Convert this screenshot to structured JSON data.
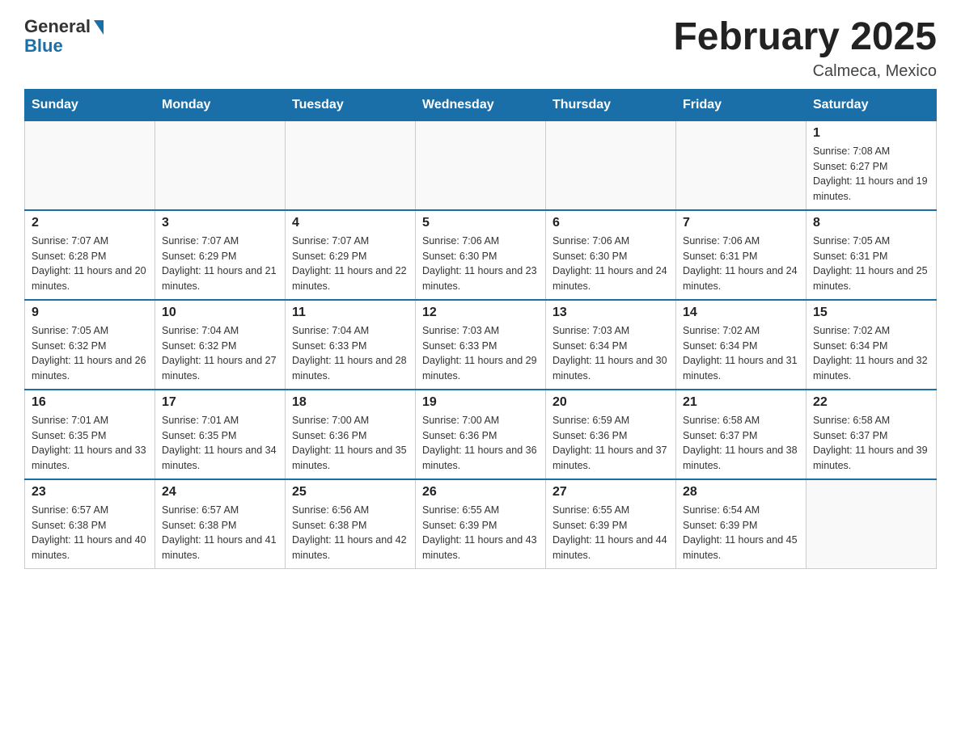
{
  "header": {
    "logo_general": "General",
    "logo_blue": "Blue",
    "month_title": "February 2025",
    "location": "Calmeca, Mexico"
  },
  "weekdays": [
    "Sunday",
    "Monday",
    "Tuesday",
    "Wednesday",
    "Thursday",
    "Friday",
    "Saturday"
  ],
  "weeks": [
    [
      {
        "day": "",
        "sunrise": "",
        "sunset": "",
        "daylight": ""
      },
      {
        "day": "",
        "sunrise": "",
        "sunset": "",
        "daylight": ""
      },
      {
        "day": "",
        "sunrise": "",
        "sunset": "",
        "daylight": ""
      },
      {
        "day": "",
        "sunrise": "",
        "sunset": "",
        "daylight": ""
      },
      {
        "day": "",
        "sunrise": "",
        "sunset": "",
        "daylight": ""
      },
      {
        "day": "",
        "sunrise": "",
        "sunset": "",
        "daylight": ""
      },
      {
        "day": "1",
        "sunrise": "Sunrise: 7:08 AM",
        "sunset": "Sunset: 6:27 PM",
        "daylight": "Daylight: 11 hours and 19 minutes."
      }
    ],
    [
      {
        "day": "2",
        "sunrise": "Sunrise: 7:07 AM",
        "sunset": "Sunset: 6:28 PM",
        "daylight": "Daylight: 11 hours and 20 minutes."
      },
      {
        "day": "3",
        "sunrise": "Sunrise: 7:07 AM",
        "sunset": "Sunset: 6:29 PM",
        "daylight": "Daylight: 11 hours and 21 minutes."
      },
      {
        "day": "4",
        "sunrise": "Sunrise: 7:07 AM",
        "sunset": "Sunset: 6:29 PM",
        "daylight": "Daylight: 11 hours and 22 minutes."
      },
      {
        "day": "5",
        "sunrise": "Sunrise: 7:06 AM",
        "sunset": "Sunset: 6:30 PM",
        "daylight": "Daylight: 11 hours and 23 minutes."
      },
      {
        "day": "6",
        "sunrise": "Sunrise: 7:06 AM",
        "sunset": "Sunset: 6:30 PM",
        "daylight": "Daylight: 11 hours and 24 minutes."
      },
      {
        "day": "7",
        "sunrise": "Sunrise: 7:06 AM",
        "sunset": "Sunset: 6:31 PM",
        "daylight": "Daylight: 11 hours and 24 minutes."
      },
      {
        "day": "8",
        "sunrise": "Sunrise: 7:05 AM",
        "sunset": "Sunset: 6:31 PM",
        "daylight": "Daylight: 11 hours and 25 minutes."
      }
    ],
    [
      {
        "day": "9",
        "sunrise": "Sunrise: 7:05 AM",
        "sunset": "Sunset: 6:32 PM",
        "daylight": "Daylight: 11 hours and 26 minutes."
      },
      {
        "day": "10",
        "sunrise": "Sunrise: 7:04 AM",
        "sunset": "Sunset: 6:32 PM",
        "daylight": "Daylight: 11 hours and 27 minutes."
      },
      {
        "day": "11",
        "sunrise": "Sunrise: 7:04 AM",
        "sunset": "Sunset: 6:33 PM",
        "daylight": "Daylight: 11 hours and 28 minutes."
      },
      {
        "day": "12",
        "sunrise": "Sunrise: 7:03 AM",
        "sunset": "Sunset: 6:33 PM",
        "daylight": "Daylight: 11 hours and 29 minutes."
      },
      {
        "day": "13",
        "sunrise": "Sunrise: 7:03 AM",
        "sunset": "Sunset: 6:34 PM",
        "daylight": "Daylight: 11 hours and 30 minutes."
      },
      {
        "day": "14",
        "sunrise": "Sunrise: 7:02 AM",
        "sunset": "Sunset: 6:34 PM",
        "daylight": "Daylight: 11 hours and 31 minutes."
      },
      {
        "day": "15",
        "sunrise": "Sunrise: 7:02 AM",
        "sunset": "Sunset: 6:34 PM",
        "daylight": "Daylight: 11 hours and 32 minutes."
      }
    ],
    [
      {
        "day": "16",
        "sunrise": "Sunrise: 7:01 AM",
        "sunset": "Sunset: 6:35 PM",
        "daylight": "Daylight: 11 hours and 33 minutes."
      },
      {
        "day": "17",
        "sunrise": "Sunrise: 7:01 AM",
        "sunset": "Sunset: 6:35 PM",
        "daylight": "Daylight: 11 hours and 34 minutes."
      },
      {
        "day": "18",
        "sunrise": "Sunrise: 7:00 AM",
        "sunset": "Sunset: 6:36 PM",
        "daylight": "Daylight: 11 hours and 35 minutes."
      },
      {
        "day": "19",
        "sunrise": "Sunrise: 7:00 AM",
        "sunset": "Sunset: 6:36 PM",
        "daylight": "Daylight: 11 hours and 36 minutes."
      },
      {
        "day": "20",
        "sunrise": "Sunrise: 6:59 AM",
        "sunset": "Sunset: 6:36 PM",
        "daylight": "Daylight: 11 hours and 37 minutes."
      },
      {
        "day": "21",
        "sunrise": "Sunrise: 6:58 AM",
        "sunset": "Sunset: 6:37 PM",
        "daylight": "Daylight: 11 hours and 38 minutes."
      },
      {
        "day": "22",
        "sunrise": "Sunrise: 6:58 AM",
        "sunset": "Sunset: 6:37 PM",
        "daylight": "Daylight: 11 hours and 39 minutes."
      }
    ],
    [
      {
        "day": "23",
        "sunrise": "Sunrise: 6:57 AM",
        "sunset": "Sunset: 6:38 PM",
        "daylight": "Daylight: 11 hours and 40 minutes."
      },
      {
        "day": "24",
        "sunrise": "Sunrise: 6:57 AM",
        "sunset": "Sunset: 6:38 PM",
        "daylight": "Daylight: 11 hours and 41 minutes."
      },
      {
        "day": "25",
        "sunrise": "Sunrise: 6:56 AM",
        "sunset": "Sunset: 6:38 PM",
        "daylight": "Daylight: 11 hours and 42 minutes."
      },
      {
        "day": "26",
        "sunrise": "Sunrise: 6:55 AM",
        "sunset": "Sunset: 6:39 PM",
        "daylight": "Daylight: 11 hours and 43 minutes."
      },
      {
        "day": "27",
        "sunrise": "Sunrise: 6:55 AM",
        "sunset": "Sunset: 6:39 PM",
        "daylight": "Daylight: 11 hours and 44 minutes."
      },
      {
        "day": "28",
        "sunrise": "Sunrise: 6:54 AM",
        "sunset": "Sunset: 6:39 PM",
        "daylight": "Daylight: 11 hours and 45 minutes."
      },
      {
        "day": "",
        "sunrise": "",
        "sunset": "",
        "daylight": ""
      }
    ]
  ]
}
